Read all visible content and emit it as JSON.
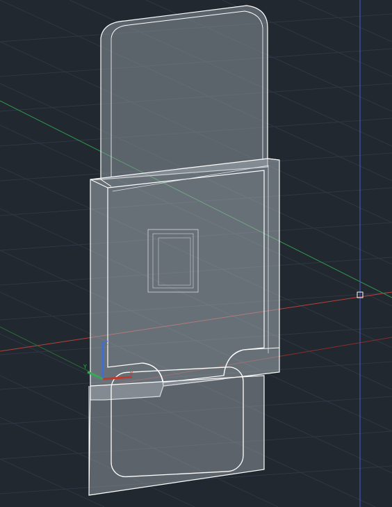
{
  "viewport": {
    "background_color": "#212830",
    "grid_minor_color": "#2c3540",
    "grid_major_color": "#3a4552",
    "model_edge_color": "#ffffff",
    "translucent_fill_color": "#aab0b6"
  },
  "axes": {
    "x_axis_color": "#c0392b",
    "y_axis_color": "#34a853",
    "z_axis_color": "#3b6fd6",
    "ucs_icon": {
      "x_label": "X",
      "y_label": "Y",
      "z_label": "Z"
    }
  },
  "crosshair": {
    "vertical_line_color": "#4a5bd8",
    "horizontal_line_color": "#c0392b",
    "cursor_icon": "pickbox-icon"
  },
  "model": {
    "description_icon": "3d-wireframe-model-icon"
  }
}
